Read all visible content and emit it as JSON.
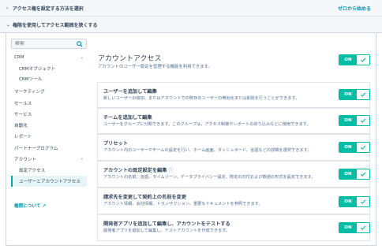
{
  "accordion": {
    "row1_title": "アクセス権を設定する方法を選択",
    "row1_link": "ゼロから始める",
    "row2_title": "権限を使用してアクセス範囲を狭くする"
  },
  "sidebar": {
    "search_placeholder": "検索",
    "items": [
      {
        "label": "CRM",
        "expandable": true
      },
      {
        "label": "CRMオブジェクト"
      },
      {
        "label": "CRMツール"
      },
      {
        "label": "マーケティング"
      },
      {
        "label": "セールス"
      },
      {
        "label": "サービス"
      },
      {
        "label": "自動化"
      },
      {
        "label": "レポート"
      },
      {
        "label": "パートナープログラム"
      },
      {
        "label": "アカウント",
        "expandable": true
      },
      {
        "label": "設定アクセス"
      },
      {
        "label": "ユーザーとアカウントアクセス",
        "selected": true
      }
    ],
    "permissions_link": "権限について"
  },
  "main": {
    "title": "アカウントアクセス",
    "description": "アカウントのユーザー設定を管理する機能を利用できます。",
    "master_toggle": "ON"
  },
  "cards": [
    {
      "title": "ユーザーを追加して編集",
      "description": "新しいユーザーの追加、またはアカウントでの既存のユーザーの無効化または削除を行うことができます。",
      "toggle": "ON"
    },
    {
      "title": "チームを追加して編集",
      "description": "ユーザーをグループに分類できます。このグループは、アクセス制御やレポートの絞り込みなどに使用できます。",
      "toggle": "ON"
    },
    {
      "title": "プリセット",
      "description": "アカウント内のユーザーやチームの設定を行い、ホーム画面、ダッシュボード、言語などの詳細を選択できます。",
      "toggle": "ON"
    },
    {
      "title": "アカウントの既定設定を編集",
      "description": "アカウントの名前、言語、タイムゾーン、データプライバシー設定、既定の日付および数値の形式を設定できます。",
      "toggle": "ON"
    },
    {
      "title": "請求先を変更して契約上の名前を変更",
      "description": "アカウント情報、会社情報、トランザクション、重要なドキュメントを参照できます。",
      "toggle": "ON"
    },
    {
      "title": "開発者アプリを追加して編集し、アカウントをテストする",
      "description": "開発者アプリを追加して編集し、テストアカウントを作成できます。",
      "toggle": "ON"
    }
  ],
  "colors": {
    "accent": "#00bda5",
    "link": "#0091ae",
    "text": "#33475b",
    "selected_bg": "#e5f5f8"
  }
}
